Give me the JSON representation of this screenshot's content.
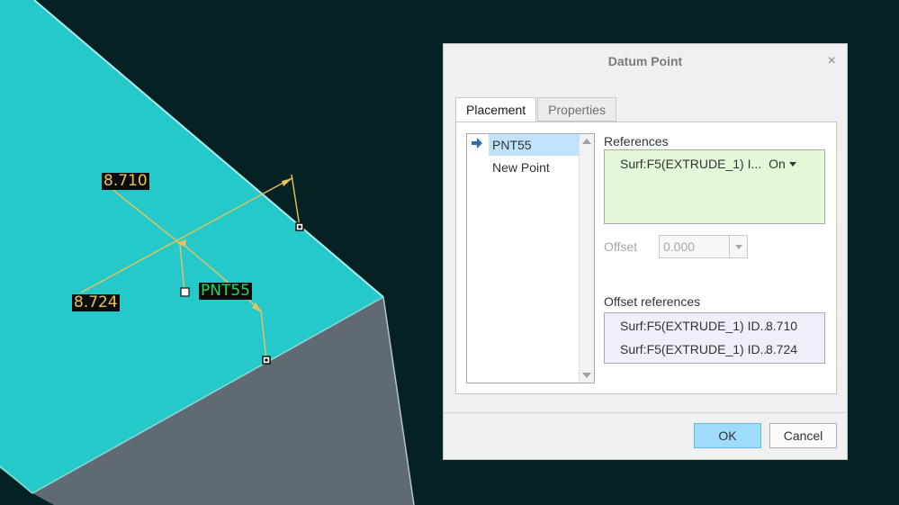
{
  "viewport": {
    "dim_label_1": "8.710",
    "dim_label_2": "8.724",
    "point_label": "PNT55"
  },
  "dialog": {
    "title": "Datum Point",
    "close_glyph": "×",
    "tabs": [
      {
        "label": "Placement",
        "active": true
      },
      {
        "label": "Properties",
        "active": false
      }
    ],
    "point_list": [
      {
        "label": "PNT55",
        "selected": true
      },
      {
        "label": "New Point",
        "selected": false
      }
    ],
    "references": {
      "label": "References",
      "items": [
        {
          "ref": "Surf:F5(EXTRUDE_1) I...",
          "type": "On"
        }
      ]
    },
    "offset": {
      "label": "Offset",
      "value": "0.000"
    },
    "offset_references": {
      "label": "Offset references",
      "items": [
        {
          "ref": "Surf:F5(EXTRUDE_1) ID...",
          "value": "8.710"
        },
        {
          "ref": "Surf:F5(EXTRUDE_1) ID...",
          "value": "8.724"
        }
      ]
    },
    "buttons": {
      "ok": "OK",
      "cancel": "Cancel"
    }
  },
  "colors": {
    "background": "#042224",
    "surface_cyan": "#26c9c9",
    "surface_gray": "#5f6a72",
    "dimension": "#e8c35a",
    "point_label": "#2fd15a",
    "ok_button": "#9fdcfb",
    "references_bg": "#e3f8d8",
    "offset_refs_bg": "#f1eefb"
  },
  "icons": {
    "active_point_marker": "arrow-right-icon",
    "close": "close-icon",
    "dropdown": "chevron-down-icon"
  }
}
